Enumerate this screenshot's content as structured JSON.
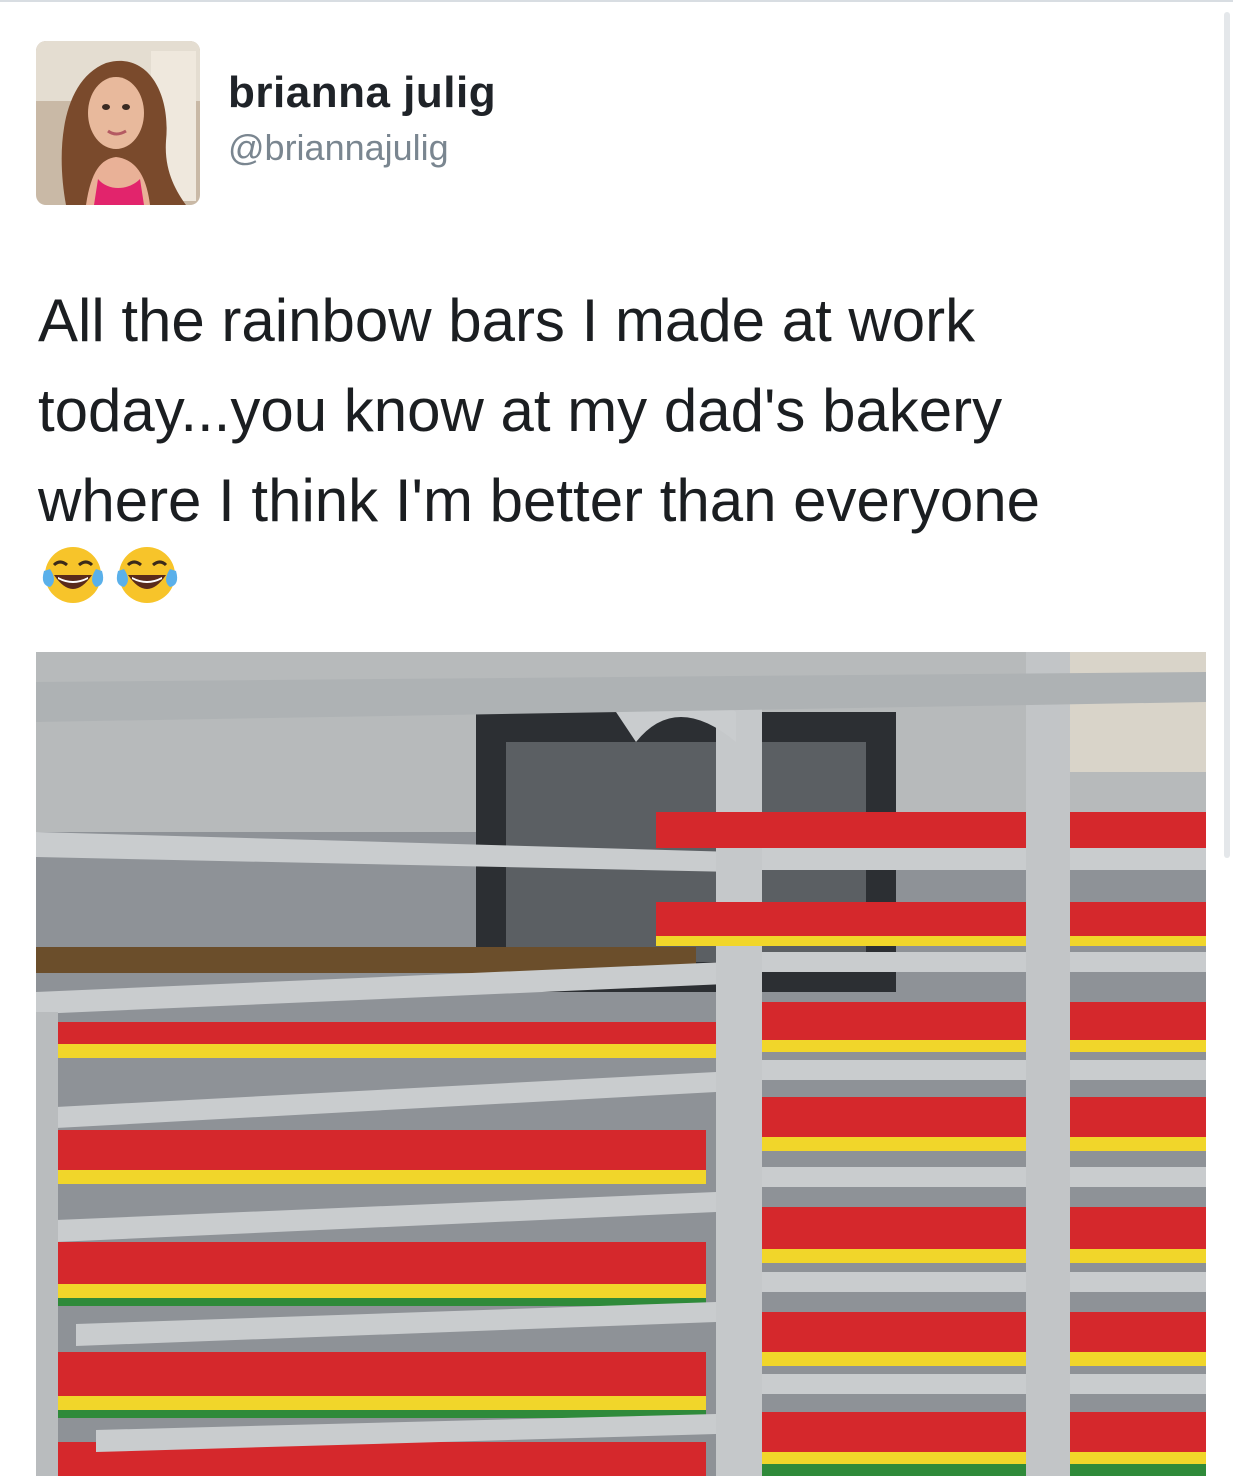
{
  "tweet": {
    "author": {
      "display_name": "brianna julig",
      "handle": "@briannajulig",
      "avatar_alt": "profile-photo"
    },
    "text_lines": [
      "All the rainbow bars I made at work",
      "today...you know at my dad's bakery",
      "where I think I'm better than everyone"
    ],
    "emojis": [
      "face-with-tears-of-joy-icon",
      "face-with-tears-of-joy-icon"
    ],
    "media": {
      "type": "photo",
      "subject": "rainbow-cookie-trays-on-bakery-rack"
    }
  },
  "colors": {
    "name_text": "#1f2328",
    "handle_text": "#7a8690",
    "body_text": "#1b1e21",
    "cake_red": "#d5282c",
    "cake_yellow": "#f1d62a",
    "cake_green": "#2f8a3a",
    "rack_steel": "#c9ccce"
  }
}
